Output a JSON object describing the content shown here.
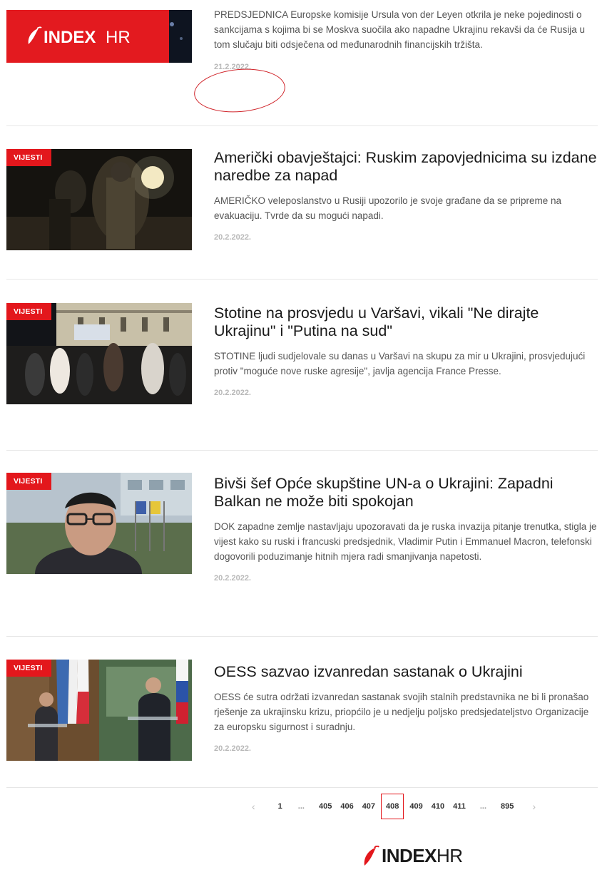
{
  "colors": {
    "brand_red": "#e3171c",
    "date_gray": "#b8b8b8",
    "divider": "#e6e6e6",
    "annotation": "#d0242a"
  },
  "articles": [
    {
      "image_logo": {
        "brand": "INDEX",
        "suffix": "HR",
        "icon": "chili-pepper-icon"
      },
      "teaser": "PREDSJEDNICA Europske komisije Ursula von der Leyen otkrila je neke pojedinosti o sankcijama s kojima bi se Moskva suočila ako napadne Ukrajinu rekavši da će Rusija u tom slučaju biti odsječena od međunarodnih financijskih tržišta.",
      "date": "21.2.2022."
    },
    {
      "badge": "VIJESTI",
      "title": "Američki obavještajci: Ruskim zapovjednicima su izdane naredbe za napad",
      "teaser": "AMERIČKO veleposlanstvo u Rusiji upozorilo je svoje građane da se pripreme na evakuaciju. Tvrde da su mogući napadi.",
      "date": "20.2.2022."
    },
    {
      "badge": "VIJESTI",
      "title": "Stotine na prosvjedu u Varšavi, vikali \"Ne dirajte Ukrajinu\" i \"Putina na sud\"",
      "teaser": "STOTINE ljudi sudjelovale su danas u Varšavi na skupu za mir u Ukrajini, prosvjedujući protiv \"moguće nove ruske agresije\", javlja agencija France Presse.",
      "date": "20.2.2022."
    },
    {
      "badge": "VIJESTI",
      "title": "Bivši šef Opće skupštine UN-a o Ukrajini: Zapadni Balkan ne može biti spokojan",
      "teaser": "DOK zapadne zemlje nastavljaju upozoravati da je ruska invazija pitanje trenutka, stigla je vijest kako su ruski i francuski predsjednik, Vladimir Putin i Emmanuel Macron, telefonski dogovorili poduzimanje hitnih mjera radi smanjivanja napetosti.",
      "date": "20.2.2022."
    },
    {
      "badge": "VIJESTI",
      "title": "OESS sazvao izvanredan sastanak o Ukrajini",
      "teaser": "OESS će sutra održati izvanredan sastanak svojih stalnih predstavnika ne bi li pronašao rješenje za ukrajinsku krizu, priopćilo je u nedjelju poljsko predsjedateljstvo Organizacije za europsku sigurnost i suradnju.",
      "date": "20.2.2022."
    }
  ],
  "pagination": {
    "prev": "‹",
    "next": "›",
    "items": [
      "1",
      "...",
      "405",
      "406",
      "407",
      "408",
      "409",
      "410",
      "411",
      "...",
      "895"
    ],
    "current": "408"
  },
  "footer": {
    "brand": "INDEX",
    "suffix": "HR",
    "icon": "chili-pepper-icon"
  }
}
